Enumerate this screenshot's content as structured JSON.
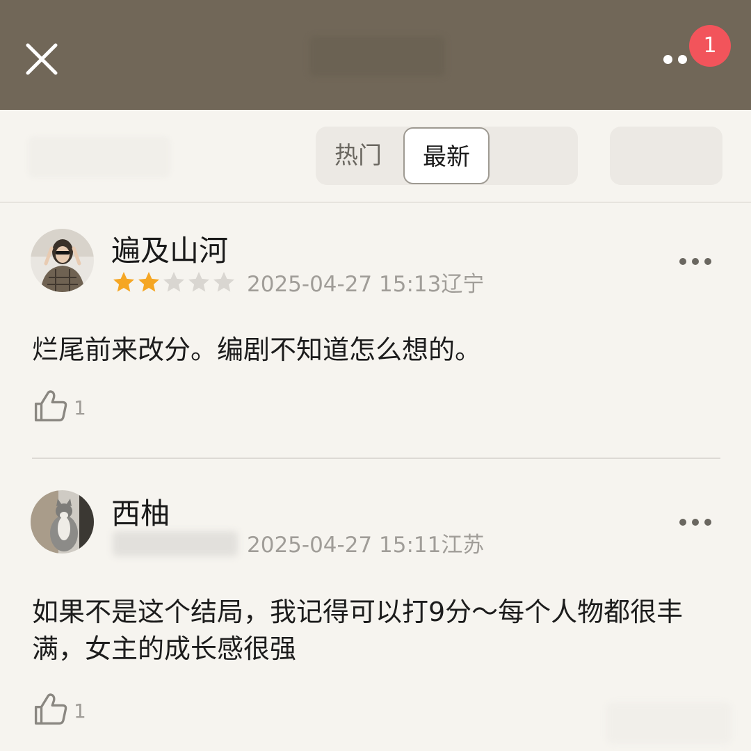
{
  "header": {
    "close_icon": "close-icon",
    "more_icon": "more-icon",
    "notification_count": "1",
    "colors": {
      "bar": "#716758",
      "badge": "#f2545b"
    }
  },
  "tabs": [
    {
      "label": "热门",
      "active": false
    },
    {
      "label": "最新",
      "active": true
    }
  ],
  "comments": [
    {
      "username": "遍及山河",
      "rating": 2,
      "rating_max": 5,
      "timestamp": "2025-04-27 15:13辽宁",
      "text": "烂尾前来改分。编剧不知道怎么想的。",
      "likes": "1"
    },
    {
      "username": "西柚",
      "timestamp": "2025-04-27 15:11江苏",
      "text": "如果不是这个结局，我记得可以打9分～每个人物都很丰满，女主的成长感很强",
      "likes": "1"
    }
  ],
  "colors": {
    "star_filled": "#f5a623",
    "star_empty": "#d9d6d1",
    "background": "#f6f4ef"
  }
}
